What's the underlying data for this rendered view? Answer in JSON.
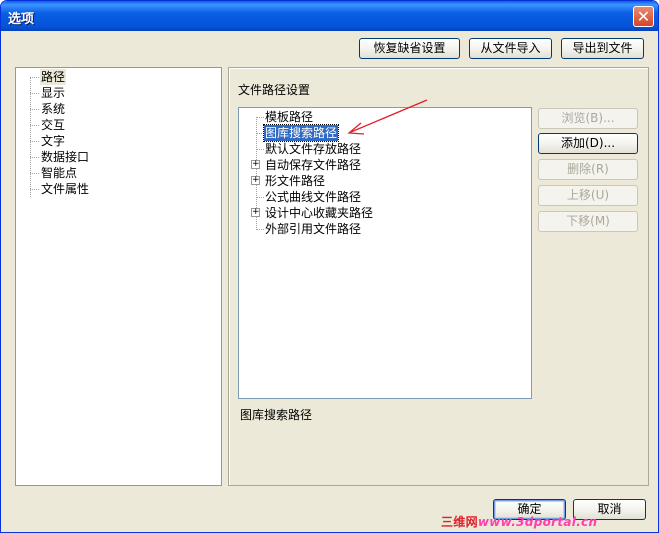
{
  "window": {
    "title": "选项"
  },
  "top_buttons": {
    "restore_defaults": "恢复缺省设置",
    "import_from_file": "从文件导入",
    "export_to_file": "导出到文件"
  },
  "nav": {
    "items": [
      {
        "label": "路径",
        "selected": true
      },
      {
        "label": "显示",
        "selected": false
      },
      {
        "label": "系统",
        "selected": false
      },
      {
        "label": "交互",
        "selected": false
      },
      {
        "label": "文字",
        "selected": false
      },
      {
        "label": "数据接口",
        "selected": false
      },
      {
        "label": "智能点",
        "selected": false
      },
      {
        "label": "文件属性",
        "selected": false
      }
    ]
  },
  "section": {
    "title": "文件路径设置"
  },
  "path_tree": {
    "items": [
      {
        "label": "模板路径",
        "expandable": false,
        "selected": false
      },
      {
        "label": "图库搜索路径",
        "expandable": false,
        "selected": true
      },
      {
        "label": "默认文件存放路径",
        "expandable": false,
        "selected": false
      },
      {
        "label": "自动保存文件路径",
        "expandable": true,
        "selected": false
      },
      {
        "label": "形文件路径",
        "expandable": true,
        "selected": false
      },
      {
        "label": "公式曲线文件路径",
        "expandable": false,
        "selected": false
      },
      {
        "label": "设计中心收藏夹路径",
        "expandable": true,
        "selected": false
      },
      {
        "label": "外部引用文件路径",
        "expandable": false,
        "selected": false
      }
    ],
    "expander_symbol": "+"
  },
  "side_buttons": {
    "browse": "浏览(B)...",
    "add": "添加(D)...",
    "delete": "删除(R)",
    "move_up": "上移(U)",
    "move_down": "下移(M)"
  },
  "selected_path_label": "图库搜索路径",
  "bottom_buttons": {
    "ok": "确定",
    "cancel": "取消"
  },
  "watermark": {
    "part1": "三维网",
    "part2": "www.3dportal.cn"
  },
  "colors": {
    "title_bar": "#0a5fe4",
    "selection": "#316ac5",
    "dialog_bg": "#ece9d8",
    "annotation_arrow": "#e0202a"
  }
}
